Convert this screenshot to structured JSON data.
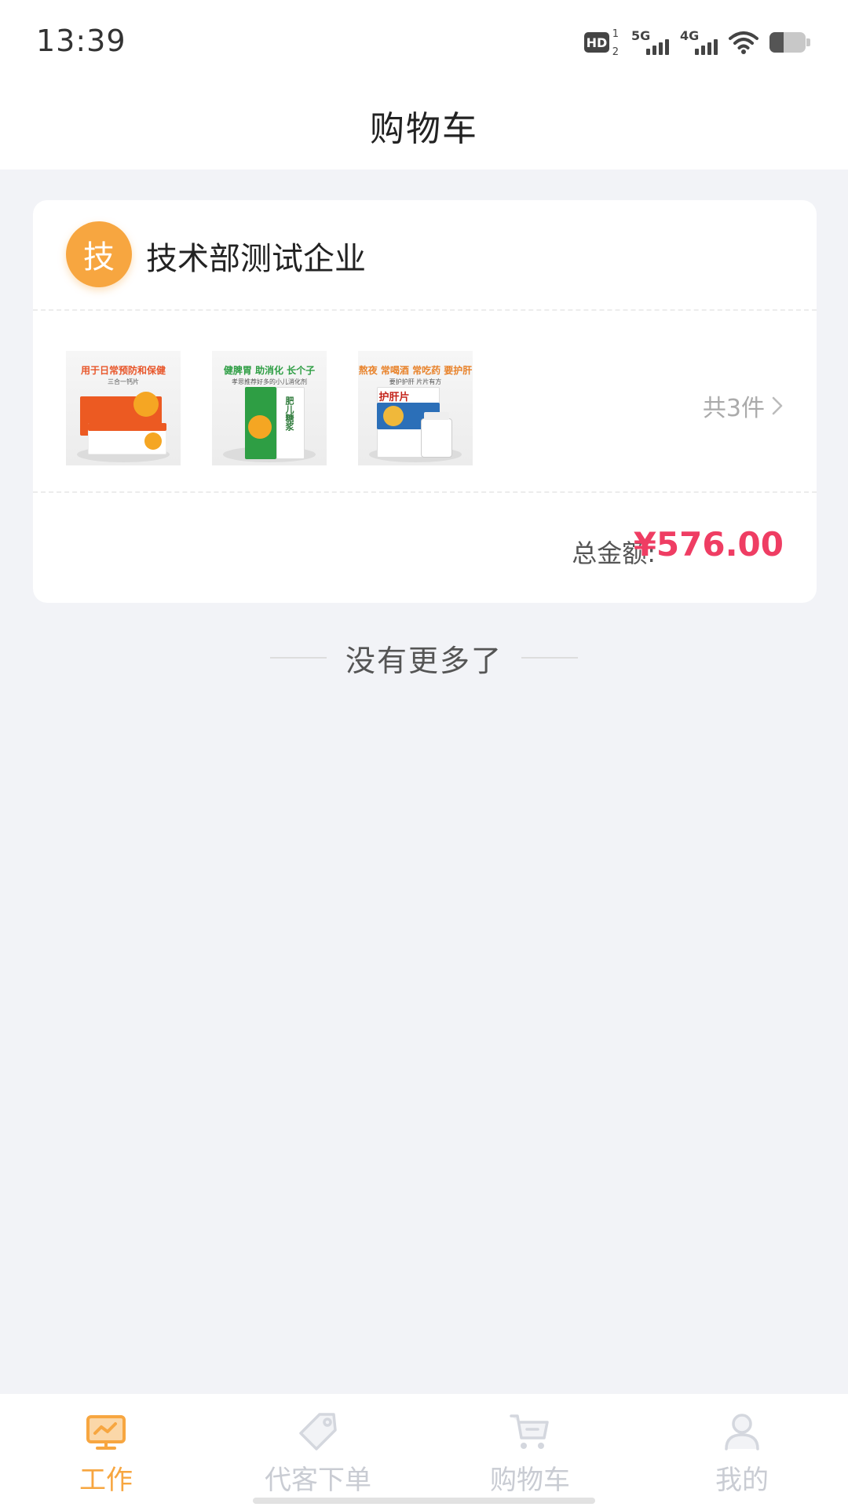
{
  "status_bar": {
    "time": "13:39",
    "hd_label": "HD",
    "hd_sup": "1",
    "hd_sub": "2",
    "signal_1_gen": "5G",
    "signal_2_gen": "4G",
    "battery_level": 0.4
  },
  "header": {
    "title": "购物车"
  },
  "cart": {
    "store_avatar": "技",
    "store_name": "技术部测试企业",
    "products": [
      {
        "headline": "用于日常预防和保健",
        "subline": "三合一钙片",
        "icon": "product-calcium-tablets"
      },
      {
        "headline": "健脾胃 助消化 长个子",
        "subline": "孝思推荐好多的小儿消化剂",
        "box_text": "肥儿糖浆",
        "icon": "product-syrup"
      },
      {
        "headline": "熬夜 常喝酒 常吃药 要护肝",
        "subline": "要护护肝 片片有方",
        "box_text": "护肝片",
        "icon": "product-liver-tablets"
      }
    ],
    "item_count_text": "共3件",
    "total_label": "总金额:",
    "total_value": "¥576.00"
  },
  "end_marker": {
    "text": "没有更多了"
  },
  "tab_bar": {
    "tabs": [
      {
        "label": "工作",
        "icon": "monitor-icon",
        "active": true
      },
      {
        "label": "代客下单",
        "icon": "tag-icon",
        "active": false
      },
      {
        "label": "购物车",
        "icon": "cart-icon",
        "active": false
      },
      {
        "label": "我的",
        "icon": "user-icon",
        "active": false
      }
    ]
  },
  "colors": {
    "accent": "#f7a640",
    "price": "#ef3d63",
    "background": "#f2f3f7",
    "tab_inactive": "#c9ccd3"
  }
}
